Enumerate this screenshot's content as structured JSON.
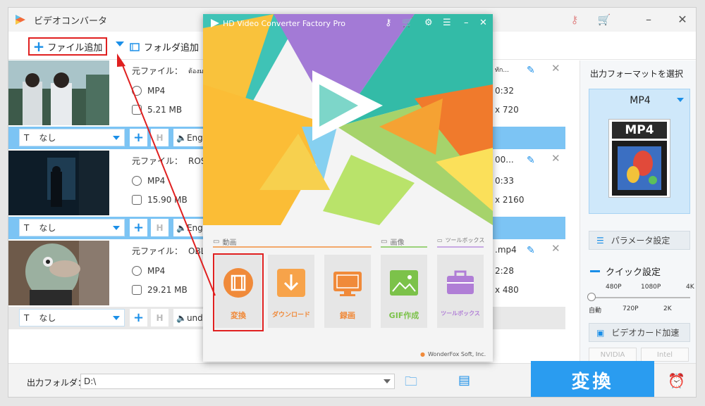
{
  "window": {
    "title": "ビデオコンバータ"
  },
  "toolbar": {
    "add_file": "ファイル追加",
    "add_folder": "フォルダ追加"
  },
  "items": [
    {
      "source_label": "元ファイル：",
      "source_name": "ต้องม",
      "right_name": "ทัก...",
      "format": "MP4",
      "duration": "0:32",
      "size": "5.21 MB",
      "resolution": "x 720",
      "subtitle": "なし",
      "audio": "Eng"
    },
    {
      "source_label": "元ファイル：",
      "source_name": "ROSÉ",
      "right_name": "00...",
      "format": "MP4",
      "duration": "0:33",
      "size": "15.90 MB",
      "resolution": "x 2160",
      "subtitle": "なし",
      "audio": "Eng"
    },
    {
      "source_label": "元ファイル：",
      "source_name": "OBLI",
      "right_name": ".mp4",
      "format": "MP4",
      "duration": "2:28",
      "size": "29.21 MB",
      "resolution": "x 480",
      "subtitle": "なし",
      "audio": "und"
    }
  ],
  "sidebar": {
    "title": "出力フォーマットを選択",
    "format": "MP4",
    "format_badge": "MP4",
    "param_button": "パラメータ設定",
    "quick_label": "クイック設定",
    "slider_top": [
      "480P",
      "1080P",
      "4K"
    ],
    "slider_bottom": [
      "自動",
      "720P",
      "2K"
    ],
    "gpu_button": "ビデオカード加速",
    "vendors": [
      "NVIDIA",
      "Intel"
    ]
  },
  "bottom": {
    "output_label": "出力フォルダ：",
    "output_path": "D:\\",
    "convert": "変換"
  },
  "popup": {
    "title": "HD Video Converter Factory Pro",
    "categories": [
      "動画",
      "画像",
      "ツールボックス"
    ],
    "tiles": [
      "変換",
      "ダウンロード",
      "録画",
      "GIF作成",
      "ツールボックス"
    ],
    "footer": "WonderFox Soft, Inc."
  }
}
